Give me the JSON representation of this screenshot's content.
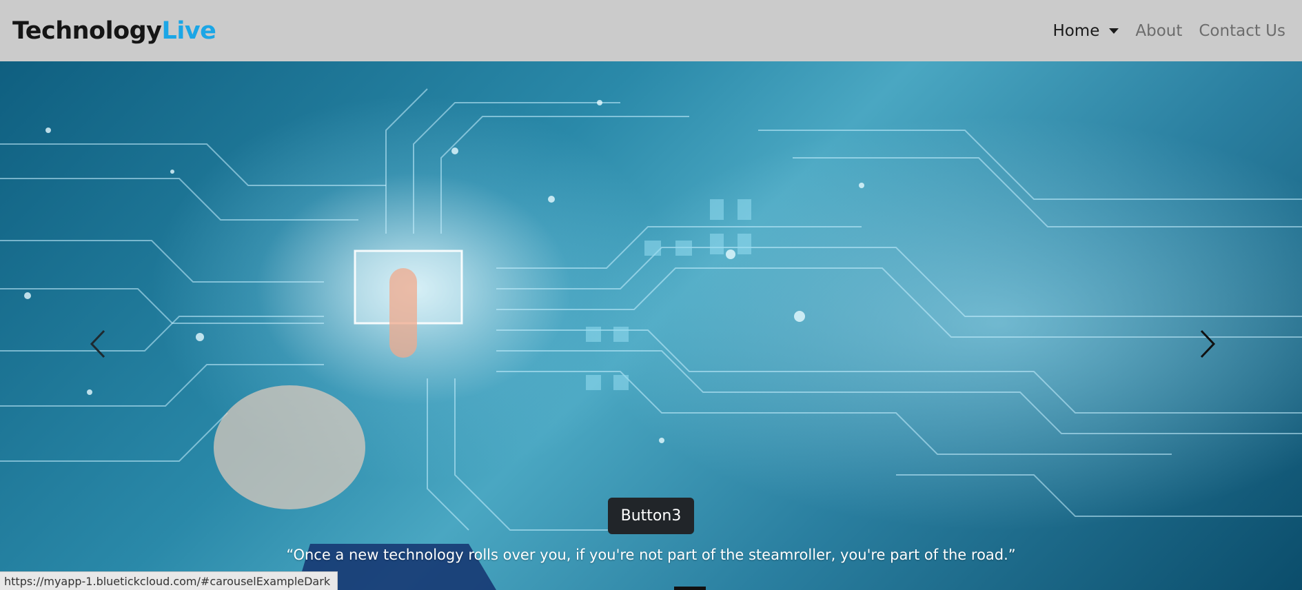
{
  "brand": {
    "name_main": "Technology",
    "name_accent": "Live"
  },
  "nav": {
    "home": "Home",
    "about": "About",
    "contact": "Contact Us"
  },
  "carousel": {
    "button_label": "Button3",
    "quote": "“Once a new technology rolls over you, if you're not part of the steamroller, you're part of the road.”",
    "prev_icon": "chevron-left-icon",
    "next_icon": "chevron-right-icon"
  },
  "status_bar": {
    "url": "https://myapp-1.bluetickcloud.com/#carouselExampleDark"
  },
  "colors": {
    "navbar_bg": "#cbcbcb",
    "brand_accent": "#1ba6e6",
    "button_bg": "#212529"
  }
}
